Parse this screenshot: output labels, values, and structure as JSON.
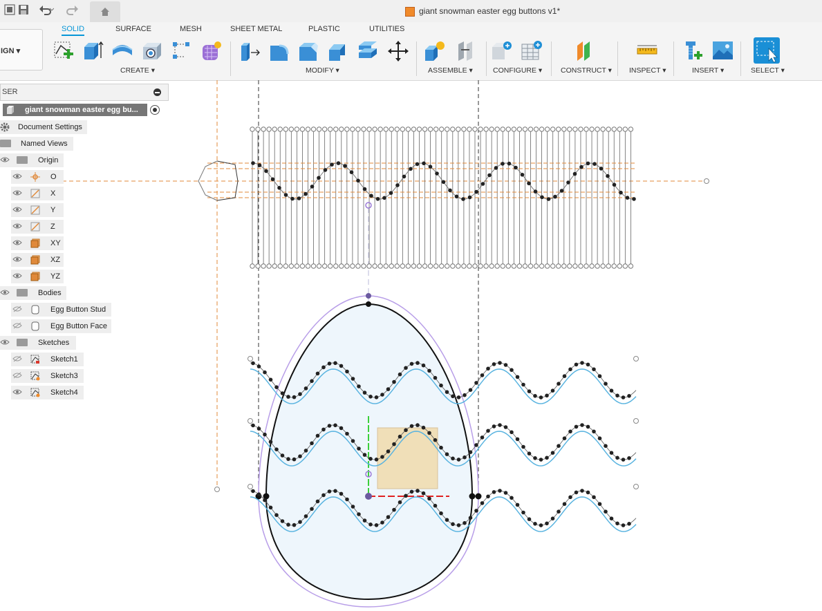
{
  "window": {
    "title": "giant snowman easter egg buttons v1*"
  },
  "quick_access": {
    "file_icon": "grid-file-icon",
    "save_icon": "save-icon",
    "undo_icon": "undo-icon",
    "redo_icon": "redo-icon",
    "home_icon": "home-icon"
  },
  "workspace": {
    "mode_label": "IGN ▾"
  },
  "tabs": [
    {
      "label": "SOLID",
      "active": true
    },
    {
      "label": "SURFACE",
      "active": false
    },
    {
      "label": "MESH",
      "active": false
    },
    {
      "label": "SHEET METAL",
      "active": false
    },
    {
      "label": "PLASTIC",
      "active": false
    },
    {
      "label": "UTILITIES",
      "active": false
    }
  ],
  "groups": [
    {
      "label": "CREATE ▾"
    },
    {
      "label": "MODIFY ▾"
    },
    {
      "label": "ASSEMBLE ▾"
    },
    {
      "label": "CONFIGURE ▾"
    },
    {
      "label": "CONSTRUCT ▾"
    },
    {
      "label": "INSPECT ▾"
    },
    {
      "label": "INSERT ▾"
    },
    {
      "label": "SELECT ▾"
    }
  ],
  "browser": {
    "header_label": "SER",
    "root": "giant snowman easter egg bu...",
    "document_settings": "Document Settings",
    "named_views": "Named Views",
    "origin": {
      "label": "Origin",
      "items": [
        "O",
        "X",
        "Y",
        "Z",
        "XY",
        "XZ",
        "YZ"
      ]
    },
    "bodies": {
      "label": "Bodies",
      "items": [
        "Egg Button Stud",
        "Egg Button Face"
      ]
    },
    "sketches": {
      "label": "Sketches",
      "items": [
        "Sketch1",
        "Sketch3",
        "Sketch4"
      ]
    }
  },
  "colors": {
    "accent": "#0696d7",
    "sketch_curve": "#5ab4e0",
    "egg_fill": "#eef6fc",
    "egg_outline": "#111111",
    "offset_outline": "#b89ee8",
    "construction": "#e0893a",
    "origin_box": "#f0dfb8"
  }
}
